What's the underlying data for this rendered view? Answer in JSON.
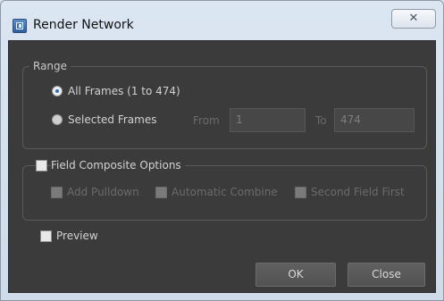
{
  "window": {
    "title": "Render Network",
    "close_symbol": "✕",
    "icon": "render-network-app-icon"
  },
  "range": {
    "title": "Range",
    "all_frames": {
      "label": "All Frames (1 to 474)",
      "selected": true
    },
    "selected_frames": {
      "label": "Selected Frames",
      "selected": false
    },
    "from": {
      "label": "From",
      "value": "1"
    },
    "to": {
      "label": "To",
      "value": "474"
    }
  },
  "field_composite": {
    "label": "Field Composite Options",
    "checked": false,
    "add_pulldown": {
      "label": "Add Pulldown",
      "checked": false,
      "enabled": false
    },
    "automatic_combine": {
      "label": "Automatic Combine",
      "checked": false,
      "enabled": false
    },
    "second_field_first": {
      "label": "Second Field First",
      "checked": false,
      "enabled": false
    }
  },
  "preview": {
    "label": "Preview",
    "checked": false
  },
  "buttons": {
    "ok": "OK",
    "close": "Close"
  },
  "colors": {
    "dialog_background": "#3b3b3b",
    "titlebar": "#d5e0ec",
    "radio_accent": "#2b6cc4"
  }
}
